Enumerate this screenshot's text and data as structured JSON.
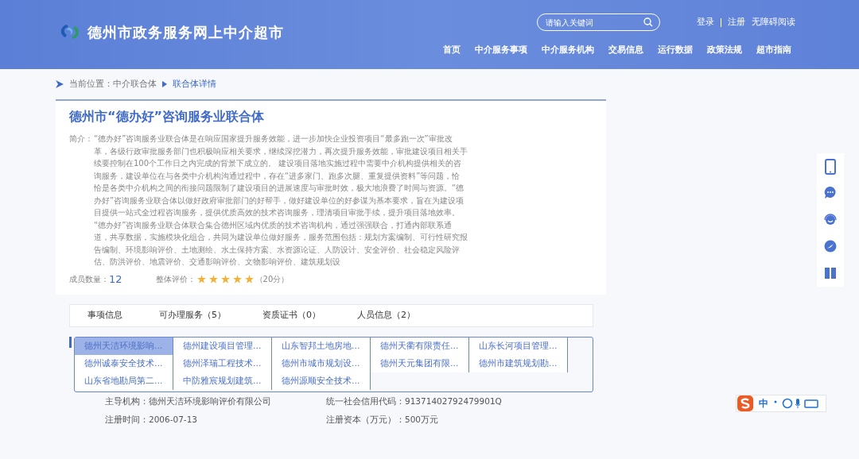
{
  "header": {
    "site_title": "德州市政务服务网上中介超市",
    "search": {
      "placeholder": "请输入关键词"
    },
    "links": [
      "登录",
      "注册",
      "无障碍阅读"
    ],
    "nav": [
      {
        "label": "首页",
        "selected": false
      },
      {
        "label": "中介服务事项",
        "selected": false
      },
      {
        "label": "中介服务机构",
        "selected": false
      },
      {
        "label": "交易信息",
        "selected": false
      },
      {
        "label": "运行数据",
        "selected": false
      },
      {
        "label": "政策法规",
        "selected": false
      },
      {
        "label": "超市指南",
        "selected": false
      }
    ]
  },
  "breadcrumb": {
    "label": "当前位置：",
    "items": [
      "中介联合体",
      "联合体详情"
    ]
  },
  "union": {
    "title": "德州市“德办好”咨询服务业联合体",
    "intro_label": "简介：",
    "intro": "“德办好”咨询服务业联合体是在响应国家提升服务效能，进一步加快企业投资项目“最多跑一次”审批改革，各级行政审批服务部门也积极响应相关要求，继续深挖潜力，再次提升服务效能，审批建设项目相关手续要控制在100个工作日之内完成的背景下成立的。 建设项目落地实施过程中需要中介机构提供相关的咨询服务，建设单位在与各类中介机构沟通过程中，存在“进多家门、跑多次腿、重复提供资料”等问题，恰恰是各类中介机构之间的衔接问题限制了建设项目的进展速度与审批时效，极大地浪费了时间与资源。“德办好”咨询服务业联合体以做好政府审批部门的好帮手，做好建设单位的好参谋为基本要求，旨在为建设项目提供一站式全过程咨询服务，提供优质高效的技术咨询服务，理清项目审批手续，提升项目落地效率。 “德办好”咨询服务业联合体联合集合德州区域内优质的技术咨询机构，通过强强联合，打通内部联系通道，共享数据，实施模块化组合，共同为建设单位做好服务，服务范围包括：规划方案编制、可行性研究报告编制、环境影响评价、土地测绘、水土保持方案、水资源论证、人防设计、安全评价、社会稳定风险评估、防洪评价、地震评价、交通影响评价、文物影响评价、建筑规划设",
    "members_label": "成员数量：",
    "members": "12",
    "rating_label": "整体评价：",
    "stars": 5,
    "score": "（20分）"
  },
  "tabs": [
    {
      "label": "事项信息",
      "selected": false
    },
    {
      "label": "可办理服务（5）",
      "selected": false
    },
    {
      "label": "资质证书（0）",
      "selected": false
    },
    {
      "label": "人员信息（2）",
      "selected": false
    }
  ],
  "members": [
    {
      "name": "德州天洁环境影响…",
      "selected": true
    },
    {
      "name": "德州建设项目管理…",
      "selected": false
    },
    {
      "name": "山东智邦土地房地…",
      "selected": false
    },
    {
      "name": "德州天衢有限责任…",
      "selected": false
    },
    {
      "name": "山东长河项目管理…",
      "selected": false
    },
    {
      "name": "德州诚泰安全技术…",
      "selected": false
    },
    {
      "name": "德州泽瑞工程技术…",
      "selected": false
    },
    {
      "name": "德州市城市规划设…",
      "selected": false
    },
    {
      "name": "德州天元集团有限…",
      "selected": false
    },
    {
      "name": "德州市建筑规划勘…",
      "selected": false
    },
    {
      "name": "山东省地勘局第二…",
      "selected": false
    },
    {
      "name": "中防雅宸规划建筑…",
      "selected": false
    },
    {
      "name": "德州源顺安全技术…",
      "selected": false
    }
  ],
  "details": [
    {
      "label": "主导机构：",
      "value": "德州天洁环境影响评价有限公司"
    },
    {
      "label": "统一社会信用代码：",
      "value": "91371402792479901Q"
    },
    {
      "label": "注册时间：",
      "value": "2006-07-13"
    },
    {
      "label": "注册资本（万元）：",
      "value": "500万元"
    }
  ],
  "side_tools": [
    {
      "kind": "phone"
    },
    {
      "kind": "chat"
    },
    {
      "kind": "service"
    },
    {
      "kind": "compass"
    },
    {
      "kind": "columns"
    }
  ],
  "ime": {
    "mode": "中"
  }
}
